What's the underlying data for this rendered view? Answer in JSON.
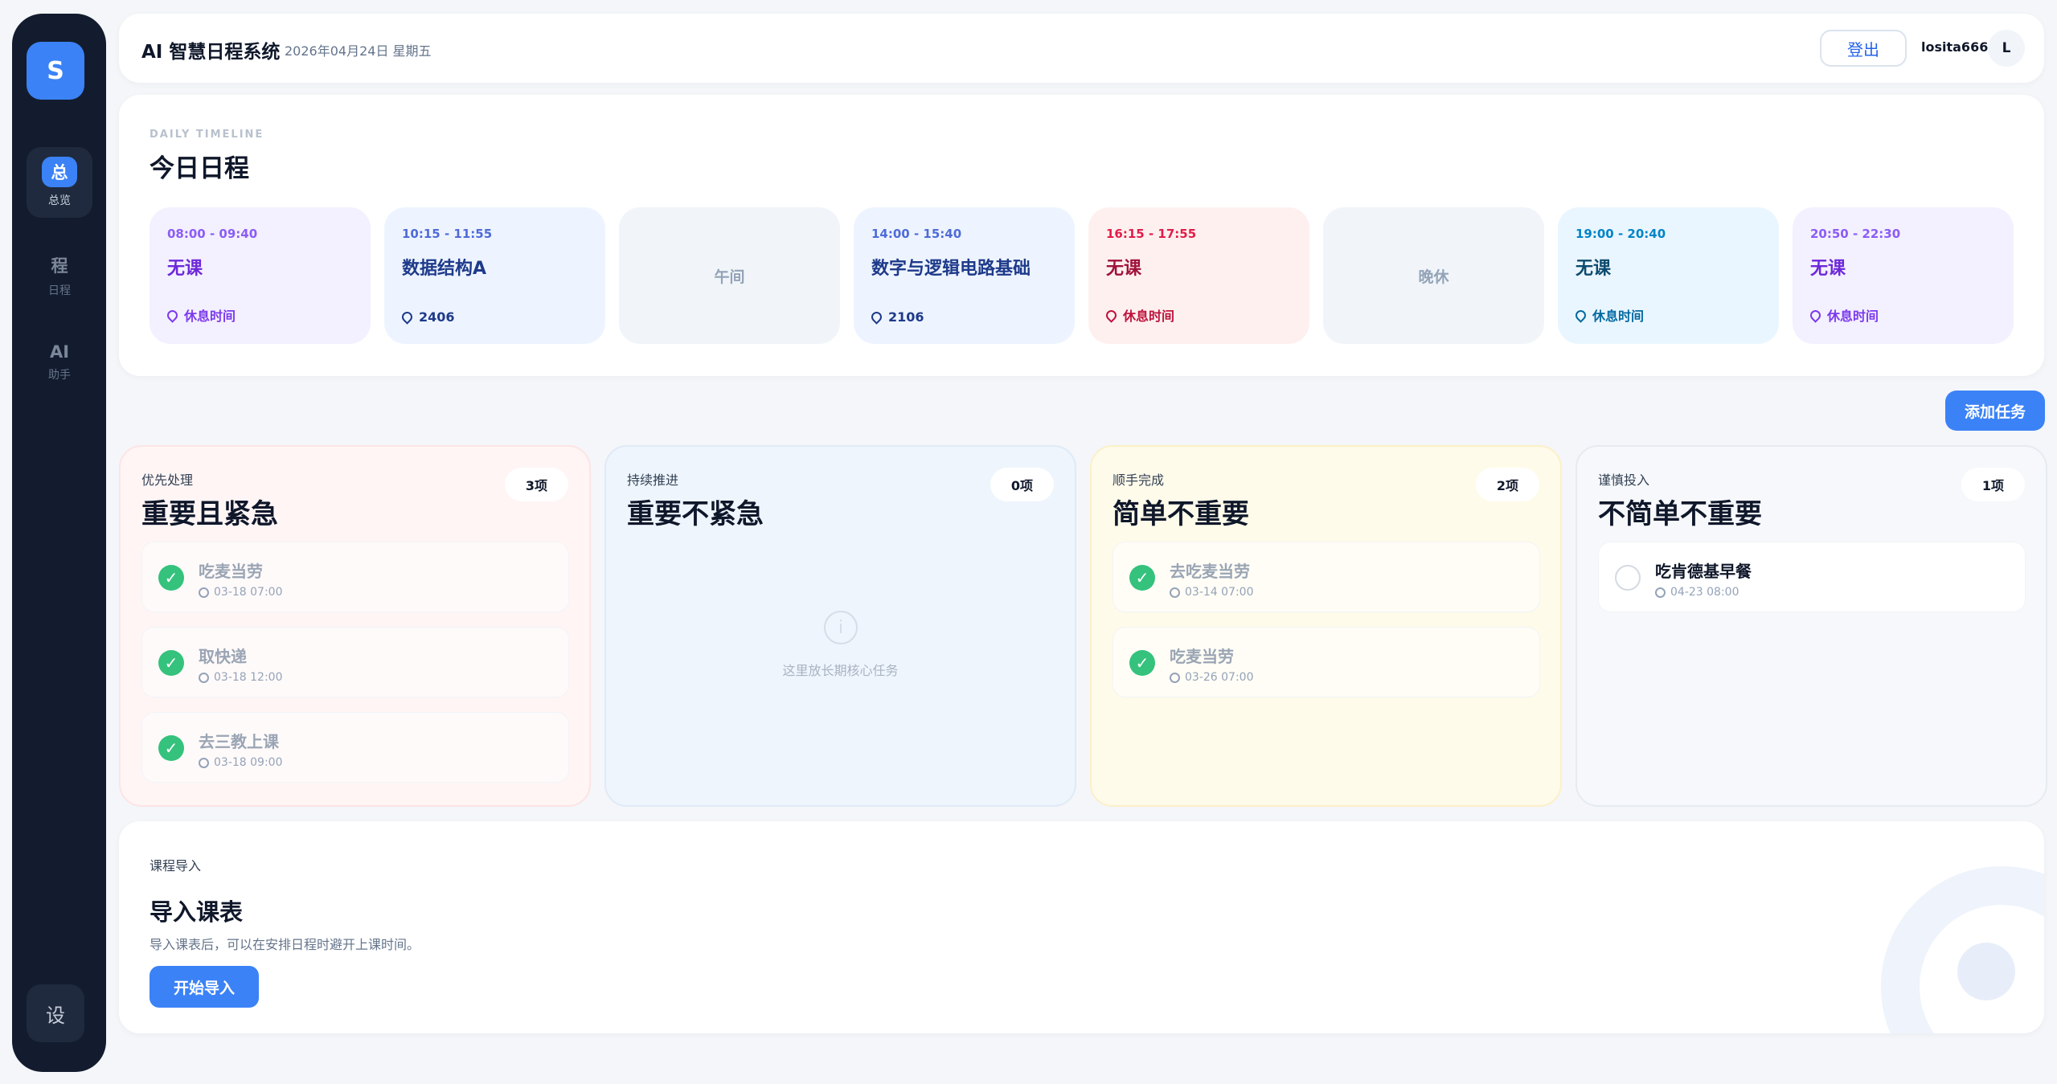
{
  "sidebar": {
    "logo": "S",
    "items": [
      {
        "glyph": "总",
        "label": "总览",
        "active": true
      },
      {
        "glyph": "程",
        "label": "日程"
      },
      {
        "glyph": "AI",
        "label": "助手"
      }
    ],
    "settings": "设"
  },
  "header": {
    "title": "AI 智慧日程系统",
    "date": "2026年04月24日 星期五",
    "logout": "登出",
    "username": "losita666",
    "avatar": "L"
  },
  "timeline": {
    "eyebrow": "DAILY TIMELINE",
    "title": "今日日程",
    "slots": [
      {
        "time": "08:00 - 09:40",
        "title": "无课",
        "location": "休息时间",
        "color": "purple"
      },
      {
        "time": "10:15 - 11:55",
        "title": "数据结构A",
        "location": "2406",
        "color": "blue"
      },
      {
        "break": "午间"
      },
      {
        "time": "14:00 - 15:40",
        "title": "数字与逻辑电路基础",
        "location": "2106",
        "color": "blue"
      },
      {
        "time": "16:15 - 17:55",
        "title": "无课",
        "location": "休息时间",
        "color": "red"
      },
      {
        "break": "晚休"
      },
      {
        "time": "19:00 - 20:40",
        "title": "无课",
        "location": "休息时间",
        "color": "cyan"
      },
      {
        "time": "20:50 - 22:30",
        "title": "无课",
        "location": "休息时间",
        "color": "purple"
      }
    ]
  },
  "add_task": "添加任务",
  "quadrants": [
    {
      "label": "优先处理",
      "title": "重要且紧急",
      "count": "3项",
      "tasks": [
        {
          "title": "吃麦当劳",
          "time": "03-18 07:00",
          "done": true
        },
        {
          "title": "取快递",
          "time": "03-18 12:00",
          "done": true
        },
        {
          "title": "去三教上课",
          "time": "03-18 09:00",
          "done": true
        }
      ]
    },
    {
      "label": "持续推进",
      "title": "重要不紧急",
      "count": "0项",
      "empty_icon": "i",
      "empty": "这里放长期核心任务"
    },
    {
      "label": "顺手完成",
      "title": "简单不重要",
      "count": "2项",
      "tasks": [
        {
          "title": "去吃麦当劳",
          "time": "03-14 07:00",
          "done": true
        },
        {
          "title": "吃麦当劳",
          "time": "03-26 07:00",
          "done": true
        }
      ]
    },
    {
      "label": "谨慎投入",
      "title": "不简单不重要",
      "count": "1项",
      "tasks": [
        {
          "title": "吃肯德基早餐",
          "time": "04-23 08:00",
          "done": false
        }
      ]
    }
  ],
  "import": {
    "eyebrow": "课程导入",
    "title": "导入课表",
    "desc": "导入课表后，可以在安排日程时避开上课时间。",
    "button": "开始导入"
  },
  "icons": {
    "check": "✓",
    "location": "pin-icon",
    "clock": "clock-icon"
  }
}
